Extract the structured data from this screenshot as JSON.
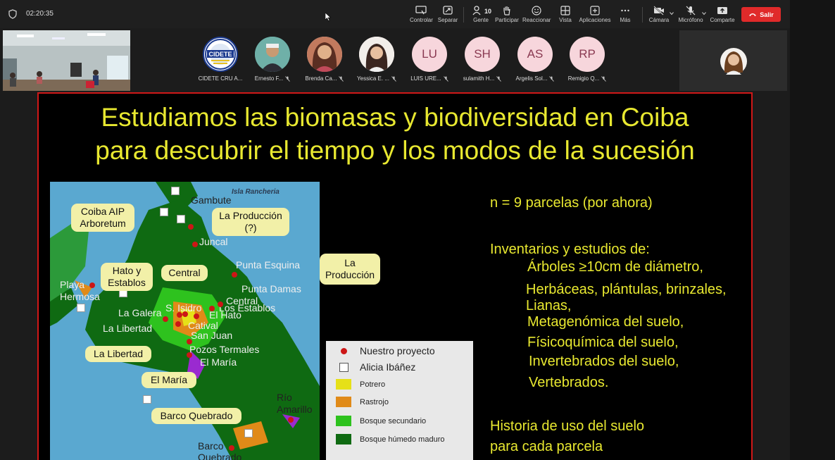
{
  "header": {
    "timer": "02:20:35",
    "toolbar": [
      {
        "icon": "screen-icon",
        "label": "Controlar"
      },
      {
        "icon": "split-icon",
        "label": "Separar"
      },
      {
        "icon": "people-icon",
        "label": "Gente",
        "count": "10"
      },
      {
        "icon": "hand-icon",
        "label": "Participar"
      },
      {
        "icon": "smile-icon",
        "label": "Reaccionar"
      },
      {
        "icon": "grid-icon",
        "label": "Vista"
      },
      {
        "icon": "plus-icon",
        "label": "Aplicaciones"
      },
      {
        "icon": "more-icon",
        "label": "Más"
      },
      {
        "icon": "camera-off-icon",
        "label": "Cámara"
      },
      {
        "icon": "mic-off-icon",
        "label": "Micrófono"
      },
      {
        "icon": "share-icon",
        "label": "Comparte"
      }
    ],
    "exit_label": "Salir",
    "accent": "#e02a2a"
  },
  "participants": [
    {
      "initials": "CIDETE",
      "name": "CIDETE CRU A...",
      "kind": "logo"
    },
    {
      "initials": "",
      "name": "Ernesto F...",
      "kind": "photo",
      "muted": true
    },
    {
      "initials": "",
      "name": "Brenda Ca...",
      "kind": "photo",
      "muted": true
    },
    {
      "initials": "",
      "name": "Yessica E. ...",
      "kind": "photo",
      "muted": true
    },
    {
      "initials": "LU",
      "name": "LUIS URE...",
      "kind": "initials",
      "muted": true
    },
    {
      "initials": "SH",
      "name": "sulamith H...",
      "kind": "initials",
      "muted": true
    },
    {
      "initials": "AS",
      "name": "Argelis Sol...",
      "kind": "initials",
      "muted": true
    },
    {
      "initials": "RP",
      "name": "Remigio Q...",
      "kind": "initials",
      "muted": true
    }
  ],
  "slide": {
    "title_line1": "Estudiamos las biomasas y biodiversidad en Coiba",
    "title_line2": "para descubrir el tiempo y los modos de la sucesión",
    "text_color": "#e8e830",
    "border_color": "#d01818",
    "map": {
      "island_labels": [
        "Isla Rancheria",
        "Gambute",
        "Juncal",
        "Punta Esquina",
        "Punta Damas",
        "Central",
        "Los Establos",
        "S. Isidro",
        "La Galera",
        "El Hato",
        "Catival",
        "La Libertad",
        "San Juan",
        "Pozos Termales",
        "El María",
        "Playa Hermosa",
        "Río Amarillo",
        "Barco Quebrado"
      ],
      "callouts": [
        "Coiba AIP Arboretum",
        "La Producción (?)",
        "La Producción",
        "Hato y Establos",
        "Central",
        "La Libertad",
        "El María",
        "Barco Quebrado"
      ],
      "legend": {
        "items": [
          {
            "label": "Nuestro proyecto",
            "marker": "red-dot"
          },
          {
            "label": "Alicia Ibáñez",
            "marker": "white-square"
          },
          {
            "label": "Potrero",
            "color": "#e6e018"
          },
          {
            "label": "Rastrojo",
            "color": "#e08a18"
          },
          {
            "label": "Bosque secundario",
            "color": "#2ec21e"
          },
          {
            "label": "Bosque húmedo maduro",
            "color": "#0f6a12"
          }
        ]
      }
    },
    "n_text": "n = 9 parcelas (por ahora)",
    "inventories_heading": "Inventarios y estudios de:",
    "inventories": [
      "Árboles ≥10cm de diámetro,",
      "Herbáceas, plántulas, brinzales,",
      "Lianas,",
      "Metagenómica del suelo,",
      "Físicoquímica del suelo,",
      "Invertebrados del suelo,",
      "Vertebrados."
    ],
    "history_line1": "Historia de uso del suelo",
    "history_line2": "para cada parcela"
  }
}
